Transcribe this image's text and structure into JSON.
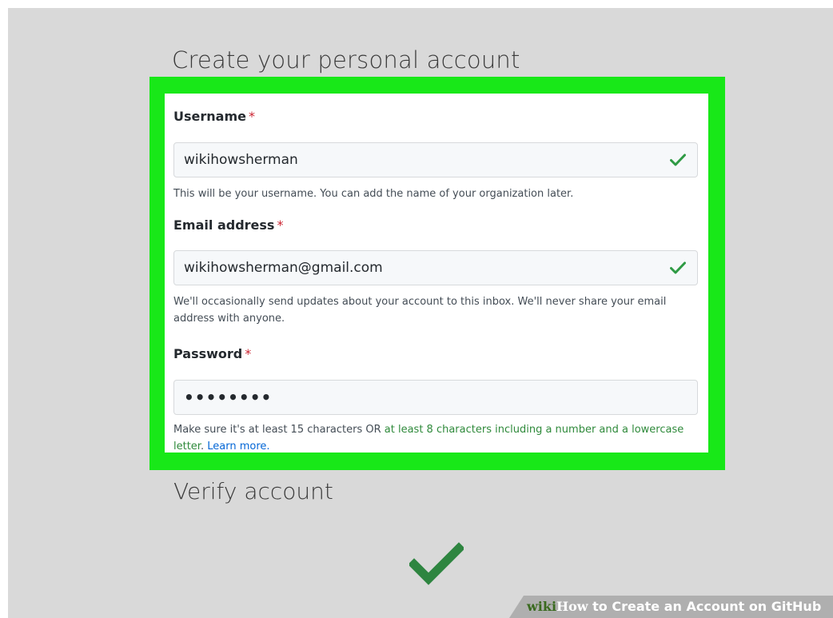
{
  "page": {
    "title": "Create your personal account"
  },
  "form": {
    "username": {
      "label": "Username",
      "required_mark": "*",
      "value": "wikihowsherman",
      "valid": true,
      "help": "This will be your username. You can add the name of your organization later."
    },
    "email": {
      "label": "Email address",
      "required_mark": "*",
      "value": "wikihowsherman@gmail.com",
      "valid": true,
      "help": "We'll occasionally send updates about your account to this inbox. We'll never share your email address with anyone."
    },
    "password": {
      "label": "Password",
      "required_mark": "*",
      "value": "••••••••",
      "help_prefix": "Make sure it's at least 15 characters OR ",
      "help_green": "at least 8 characters including a number and a lowercase letter",
      "help_mid": ". ",
      "help_link": "Learn more."
    }
  },
  "verify": {
    "title": "Verify account"
  },
  "watermark": {
    "wiki": "wiki",
    "how": "How",
    "rest": " to Create an Account on GitHub"
  },
  "icons": {
    "field_valid": "check-icon",
    "verify": "check-icon"
  },
  "colors": {
    "highlight": "#18e818",
    "check": "#2e9a44",
    "required": "#cb2431",
    "link": "#0366d6",
    "hint_green": "#2f8a3b"
  }
}
